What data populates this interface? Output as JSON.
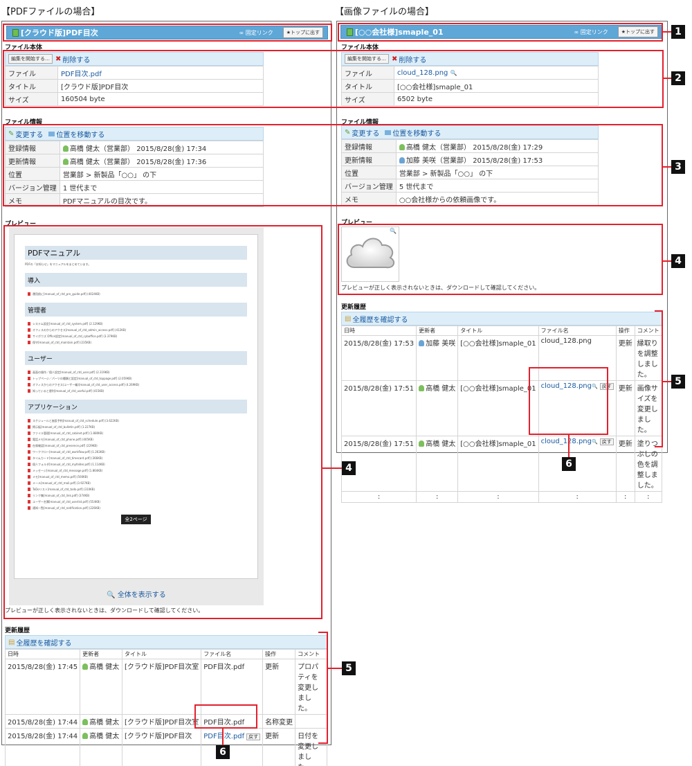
{
  "captions": {
    "left": "【PDFファイルの場合】",
    "right": "【画像ファイルの場合】"
  },
  "labels": {
    "fixlink": "固定リンク",
    "top": "トップに出す",
    "file_body": "ファイル本体",
    "file_info": "ファイル情報",
    "preview": "プレビュー",
    "history": "更新履歴",
    "start_edit": "編集を開始する…",
    "delete": "削除する",
    "change": "変更する",
    "move": "位置を移動する",
    "view_all_history": "全履歴を確認する",
    "preview_note": "プレビューが正しく表示されないときは、ダウンロードして確認してください。",
    "show_all": "全体を表示する",
    "back": "戻す"
  },
  "keys": {
    "file": "ファイル",
    "title": "タイトル",
    "size": "サイズ",
    "registered": "登録情報",
    "updated": "更新情報",
    "location": "位置",
    "version": "バージョン管理",
    "memo": "メモ"
  },
  "hist_headers": [
    "日時",
    "更新者",
    "タイトル",
    "ファイル名",
    "操作",
    "コメント"
  ],
  "pdf": {
    "window_title": "[クラウド版]PDF目次",
    "file": "PDF目次.pdf",
    "title": "[クラウド版]PDF目次",
    "size": "160504 byte",
    "registered_user": "高橋 健太（営業部）",
    "registered_date": "2015/8/28(金) 17:34",
    "updated_user": "高橋 健太（営業部）",
    "updated_date": "2015/8/28(金) 17:36",
    "location": "営業部 > 新製品「○○」 の下",
    "version": "1 世代まで",
    "memo": "PDFマニュアルの目次です。",
    "preview": {
      "title": "PDFマニュアル",
      "intro": "PDFの「お知らせ」をマニュアルをまとめています。",
      "sections": [
        {
          "name": "導入",
          "items": [
            "運用前に[manual_of_ctd_pre_guide.pdf] (4024KB)"
          ]
        },
        {
          "name": "管理者",
          "items": [
            "システム設定[manual_of_ctd_system.pdf] (2.129KB)",
            "オフィスのからのアクセス[manual_of_ctd_admin_access.pdf] (412KB)",
            "サイボウズ Office設定[manual_of_ctd_cyboffice.pdf] (3.379KB)",
            "保守[manual_of_ctd_maintain.pdf] (235KB)"
          ]
        },
        {
          "name": "ユーザー",
          "items": [
            "画面の操作／個人設定[manual_of_ctd_user.pdf] (2.319KB)",
            "トップページ／パーツの種類と設定[manual_of_ctd_toppage.pdf] (2.059KB)",
            "オフィスからのアクセス(ユーザー編)[manual_of_ctd_user_access.pdf] (4.269KB)",
            "知っていると便利[manual_of_ctd_useful.pdf] (415KB)"
          ]
        },
        {
          "name": "アプリケーション",
          "items": [
            "スケジュールと施設予約[manual_of_ctd_schedule.pdf] (3.622KB)",
            "掲示板[manual_of_ctd_bulletin.pdf] (1.227KB)",
            "ファイル管理[manual_of_ctd_cabinet.pdf] (1.880KB)",
            "電話メモ[manual_of_ctd_phone.pdf] (405KB)",
            "在席確認[manual_of_ctd_presence.pdf] (229KB)",
            "ワークフロー[manual_of_ctd_workflow.pdf] (1.263KB)",
            "タイムカード[manual_of_ctd_timecard.pdf] (366KB)",
            "個人フォルダ[manual_of_ctd_myfolder.pdf] (1.114KB)",
            "メッセージ[manual_of_ctd_message.pdf] (1.864KB)",
            "メモ[manual_of_ctd_memo.pdf] (500KB)",
            "メール[manual_of_ctd_mail.pdf] (3.927KB)",
            "ToDoリスト[manual_of_ctd_todo.pdf] (310KB)",
            "リンク集[manual_of_ctd_link.pdf] (374KB)",
            "ユーザー名簿[manual_of_ctd_userlist.pdf] (554KB)",
            "通知一覧[manual_of_ctd_notification.pdf] (226KB)"
          ]
        }
      ],
      "pages": "全2ページ"
    },
    "history": [
      {
        "date": "2015/8/28(金) 17:45",
        "user": "高橋 健太",
        "title": "[クラウド版]PDF目次室",
        "file": "PDF目次.pdf",
        "op": "更新",
        "comment": "プロパティを変更しました。"
      },
      {
        "date": "2015/8/28(金) 17:44",
        "user": "高橋 健太",
        "title": "[クラウド版]PDF目次室",
        "file": "PDF目次.pdf",
        "op": "名称変更",
        "comment": ""
      },
      {
        "date": "2015/8/28(金) 17:44",
        "user": "高橋 健太",
        "title": "[クラウド版]PDF目次",
        "file": "PDF目次.pdf",
        "op": "更新",
        "comment": "日付を変更しました。"
      },
      {
        "date": ":",
        "user": ":",
        "title": ":",
        "file": ":",
        "op": ":",
        "comment": ":"
      }
    ]
  },
  "img": {
    "window_title": "[○○会社様]smaple_01",
    "file": "cloud_128.png",
    "title": "[○○会社様]smaple_01",
    "size": "6502 byte",
    "registered_user": "高橋 健太（営業部）",
    "registered_date": "2015/8/28(金) 17:29",
    "updated_user": "加藤 美咲（営業部）",
    "updated_date": "2015/8/28(金) 17:53",
    "location": "営業部 > 新製品「○○」 の下",
    "version": "5 世代まで",
    "memo": "○○会社様からの依頼画像です。",
    "history": [
      {
        "date": "2015/8/28(金) 17:53",
        "user": "加藤 美咲",
        "title": "[○○会社様]smaple_01",
        "file": "cloud_128.png",
        "op": "更新",
        "comment": "縁取りを調整しました。"
      },
      {
        "date": "2015/8/28(金) 17:51",
        "user": "高橋 健太",
        "title": "[○○会社様]smaple_01",
        "file": "cloud_128.png",
        "op": "更新",
        "comment": "画像サイズを変更しました。"
      },
      {
        "date": "2015/8/28(金) 17:51",
        "user": "高橋 健太",
        "title": "[○○会社様]smaple_01",
        "file": "cloud_128.png",
        "op": "更新",
        "comment": "塗りつぶしの色を調整しました。"
      },
      {
        "date": ":",
        "user": ":",
        "title": ":",
        "file": ":",
        "op": ":",
        "comment": ":"
      }
    ]
  },
  "callouts": [
    "1",
    "2",
    "3",
    "4",
    "5",
    "6"
  ]
}
